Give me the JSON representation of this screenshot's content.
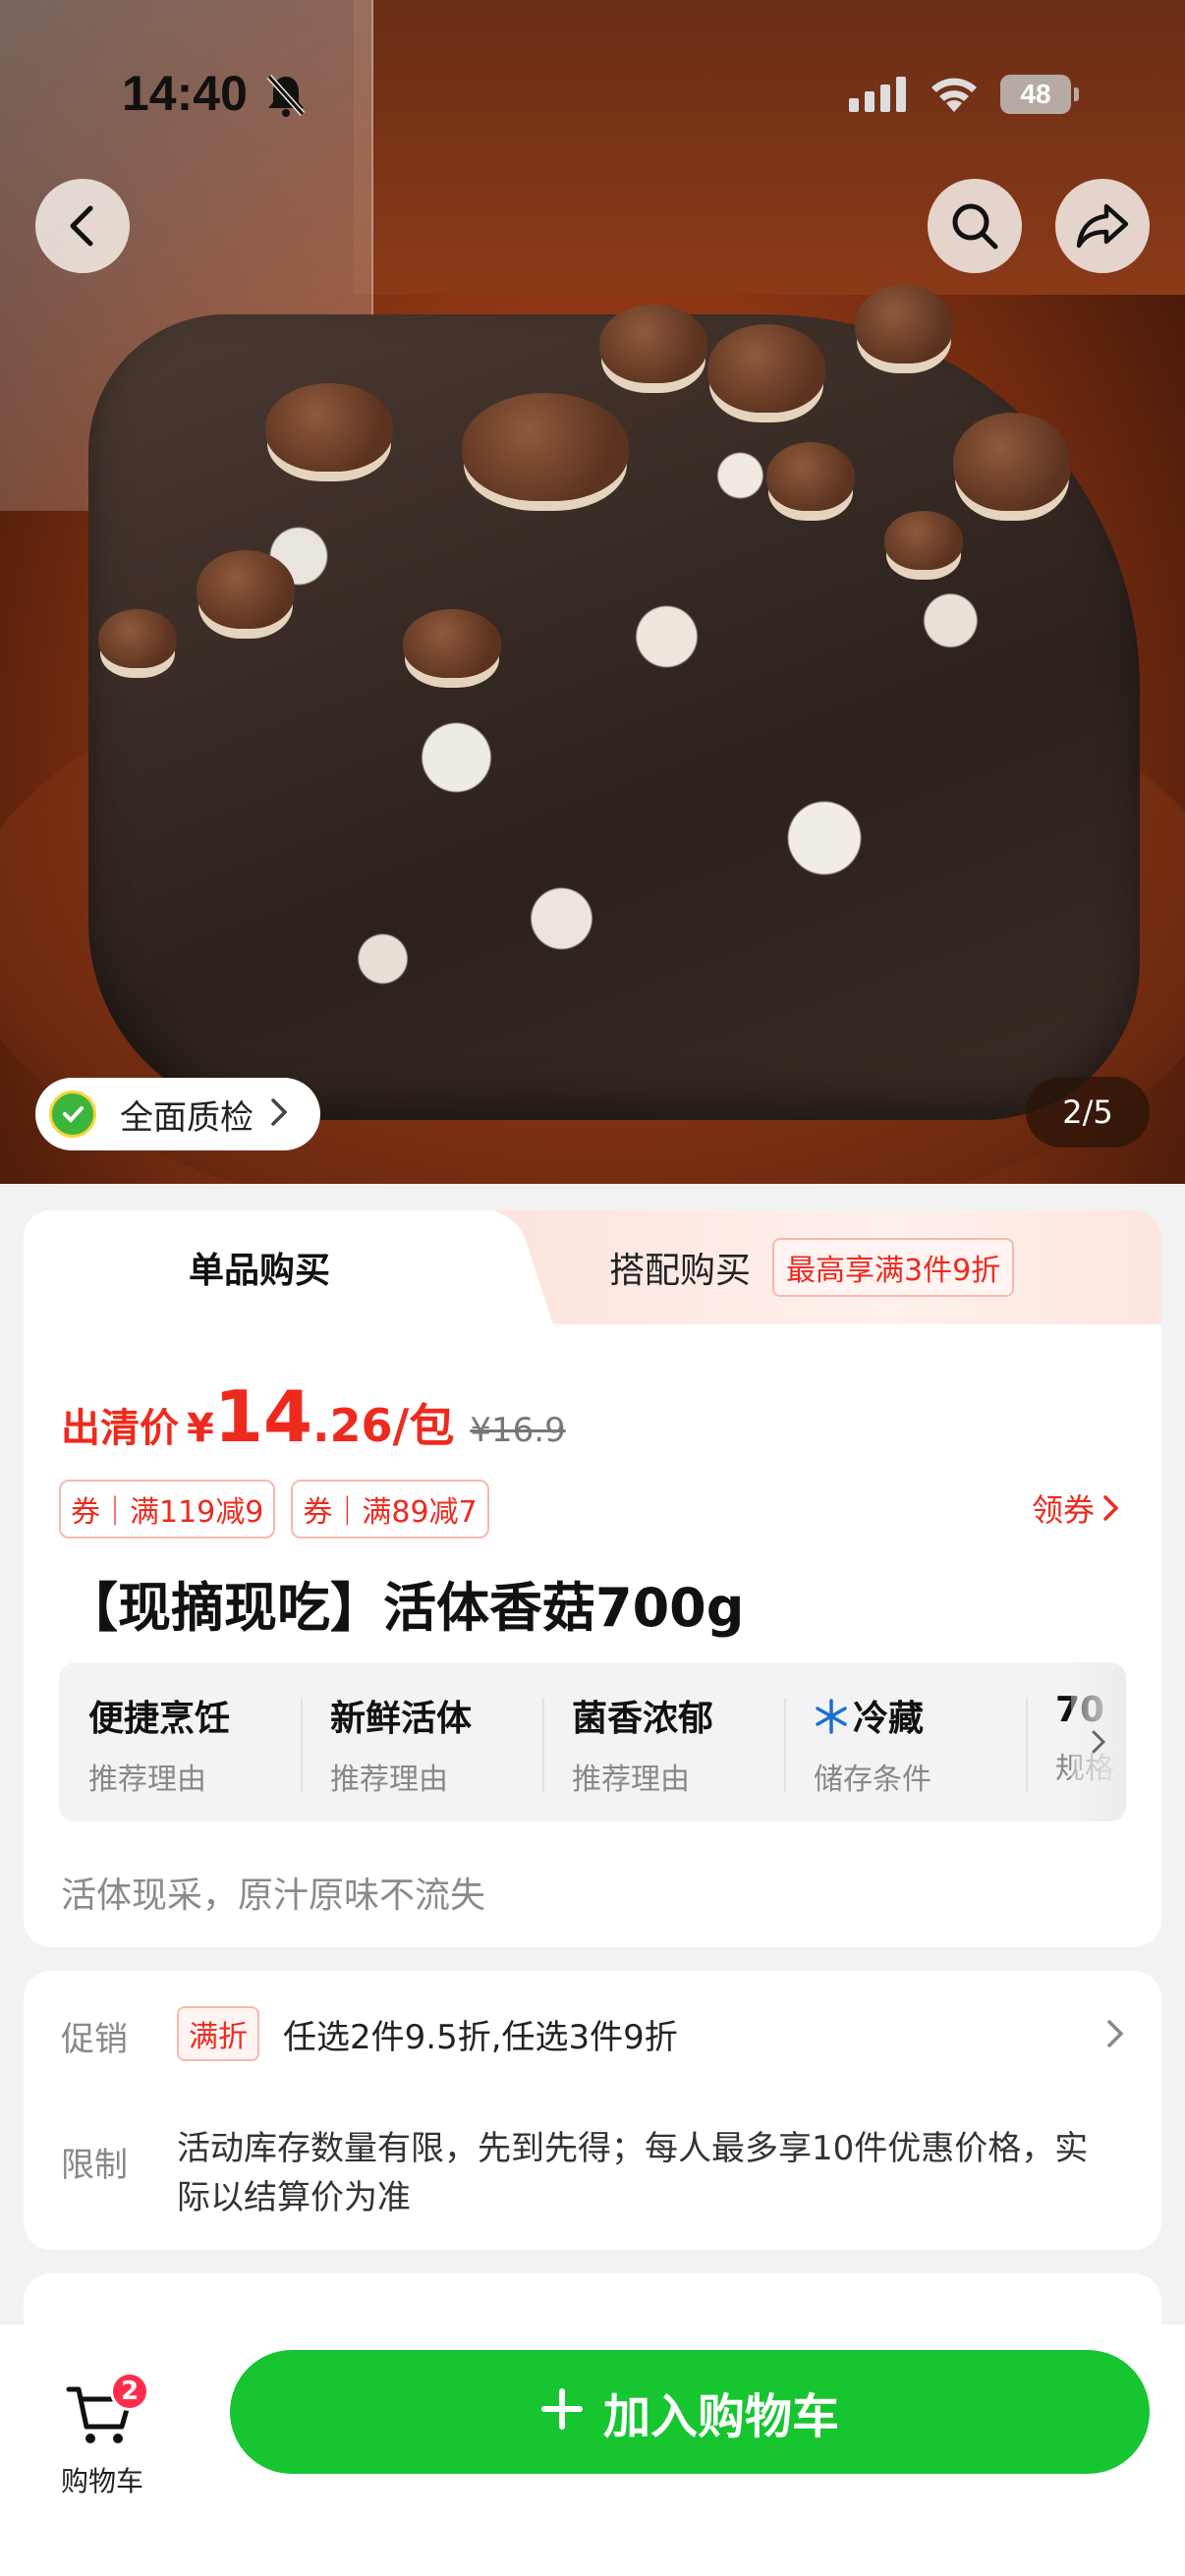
{
  "status_bar": {
    "time": "14:40",
    "battery": "48"
  },
  "hero": {
    "image_counter": "2/5",
    "quality_check_label": "全面质检",
    "quality_badge_text": "全面质检"
  },
  "purchase_tabs": {
    "single_label": "单品购买",
    "bundle_label": "搭配购买",
    "bundle_badge": "最高享满3件9折"
  },
  "price": {
    "prefix": "出清价",
    "currency": "¥",
    "integer": "14",
    "decimal": ".26",
    "unit": "/包",
    "original": "¥16.9"
  },
  "coupons": [
    {
      "label": "券｜满119减9"
    },
    {
      "label": "券｜满89减7"
    }
  ],
  "get_coupon_label": "领券",
  "product": {
    "title": "【现摘现吃】活体香菇700g",
    "subtitle": "活体现采，原汁原味不流失"
  },
  "features": [
    {
      "title": "便捷烹饪",
      "sub": "推荐理由"
    },
    {
      "title": "新鲜活体",
      "sub": "推荐理由"
    },
    {
      "title": "菌香浓郁",
      "sub": "推荐理由"
    },
    {
      "title": "冷藏",
      "sub": "储存条件"
    },
    {
      "title": "70",
      "sub": "规格"
    }
  ],
  "promotion": {
    "promo_label": "促销",
    "promo_tag": "满折",
    "promo_text": "任选2件9.5折,任选3件9折",
    "limit_label": "限制",
    "limit_text": "活动库存数量有限，先到先得；每人最多享10件优惠价格，实际以结算价为准"
  },
  "bottom_bar": {
    "cart_label": "购物车",
    "cart_count": "2",
    "add_to_cart_label": "加入购物车"
  },
  "colors": {
    "accent_red": "#ee2a1e",
    "primary_green": "#17c531"
  }
}
